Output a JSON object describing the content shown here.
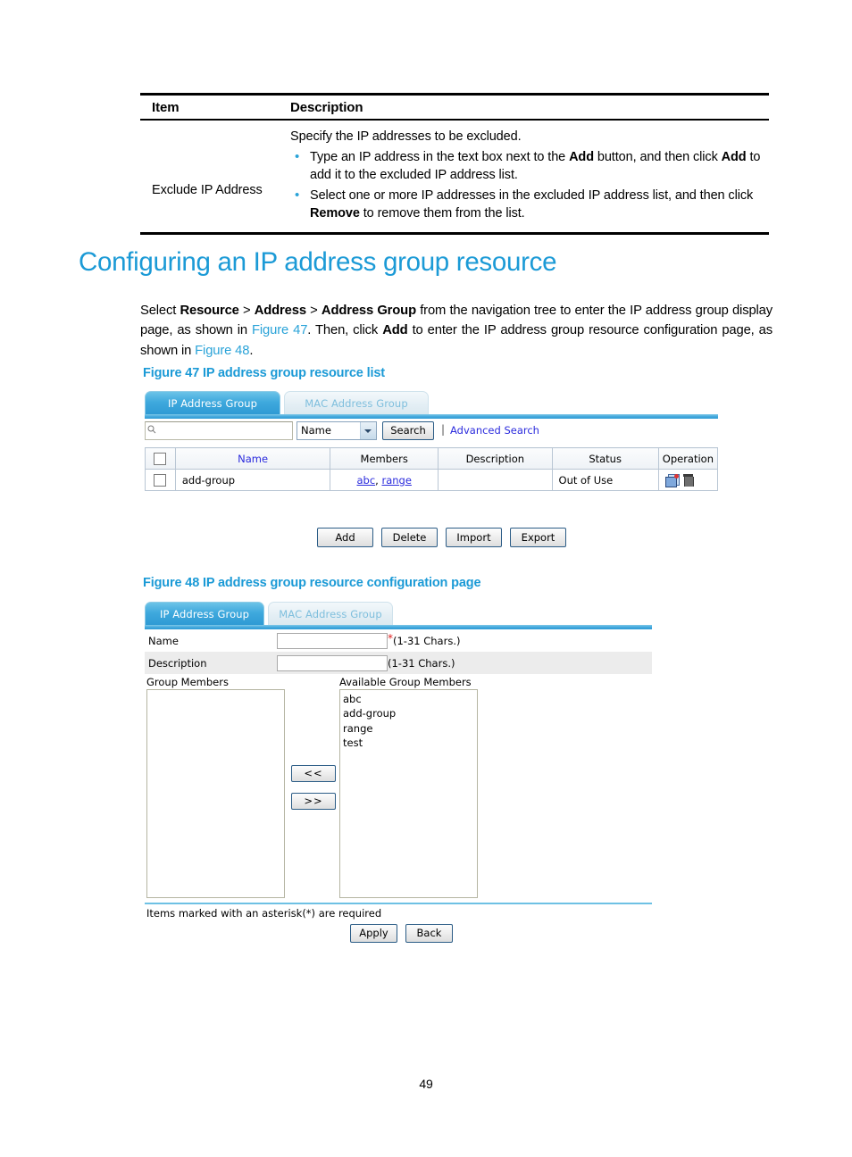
{
  "reference_table": {
    "headers": {
      "item": "Item",
      "description": "Description"
    },
    "row": {
      "item": "Exclude IP Address",
      "intro": "Specify the IP addresses to be excluded.",
      "bullets": [
        "Type an IP address in the text box next to the Add button, and then click Add to add it to the excluded IP address list.",
        "Select one or more IP addresses in the excluded IP address list, and then click Remove to remove them from the list."
      ],
      "bullet1_part1": "Type an IP address in the text box next to the ",
      "bullet1_bold1": "Add",
      "bullet1_part2": " button, and then click ",
      "bullet1_bold2": "Add",
      "bullet1_part3": " to add it to the excluded IP address list.",
      "bullet2_part1": "Select one or more IP addresses in the excluded IP address list, and then click ",
      "bullet2_bold1": "Remove",
      "bullet2_part2": " to remove them from the list."
    }
  },
  "heading": "Configuring an IP address group resource",
  "intro_paragraph": {
    "p1": "Select ",
    "b1": "Resource",
    "sep1": " > ",
    "b2": "Address",
    "sep2": " > ",
    "b3": "Address Group",
    "p2": " from the navigation tree to enter the IP address group display page, as shown in ",
    "x1": "Figure 47",
    "p3": ". Then, click ",
    "b4": "Add",
    "p4": " to enter the IP address group resource configuration page, as shown in ",
    "x2": "Figure 48",
    "p5": "."
  },
  "figure47": {
    "caption": "Figure 47 IP address group resource list",
    "tabs": [
      {
        "label": "IP Address Group",
        "active": true
      },
      {
        "label": "MAC Address Group",
        "active": false
      }
    ],
    "search": {
      "input_value": "",
      "placeholder": "",
      "field_select": "Name",
      "search_button": "Search",
      "separator": "|",
      "advanced_link": "Advanced Search"
    },
    "table": {
      "columns": [
        "",
        "Name",
        "Members",
        "Description",
        "Status",
        "Operation"
      ],
      "rows": [
        {
          "name": "add-group",
          "members": [
            "abc",
            "range"
          ],
          "members_sep": ", ",
          "description": "",
          "status": "Out of Use",
          "operation_icons": [
            "edit-icon",
            "delete-icon"
          ]
        }
      ]
    },
    "buttons": [
      "Add",
      "Delete",
      "Import",
      "Export"
    ]
  },
  "figure48": {
    "caption": "Figure 48 IP address group resource configuration page",
    "tabs": [
      {
        "label": "IP Address Group",
        "active": true
      },
      {
        "label": "MAC Address Group",
        "active": false
      }
    ],
    "fields": [
      {
        "label": "Name",
        "value": "",
        "required_mark": "*",
        "hint": "(1-31 Chars.)"
      },
      {
        "label": "Description",
        "value": "",
        "required_mark": "",
        "hint": "(1-31 Chars.)"
      }
    ],
    "group_members": {
      "label": "Group Members",
      "items": []
    },
    "available_group_members": {
      "label": "Available Group Members",
      "items": [
        "abc",
        "add-group",
        "range",
        "test"
      ]
    },
    "transfer_buttons": [
      "<<",
      ">>"
    ],
    "footnote": "Items marked with an asterisk(*) are required",
    "buttons": [
      "Apply",
      "Back"
    ]
  },
  "page_number": "49",
  "colors": {
    "accent_blue": "#1b9ad6",
    "link_blue": "#2b2bdd",
    "tab_active": "#3fa9dd",
    "required_red": "#e02020",
    "bullet_blue": "#2aa3d8"
  }
}
